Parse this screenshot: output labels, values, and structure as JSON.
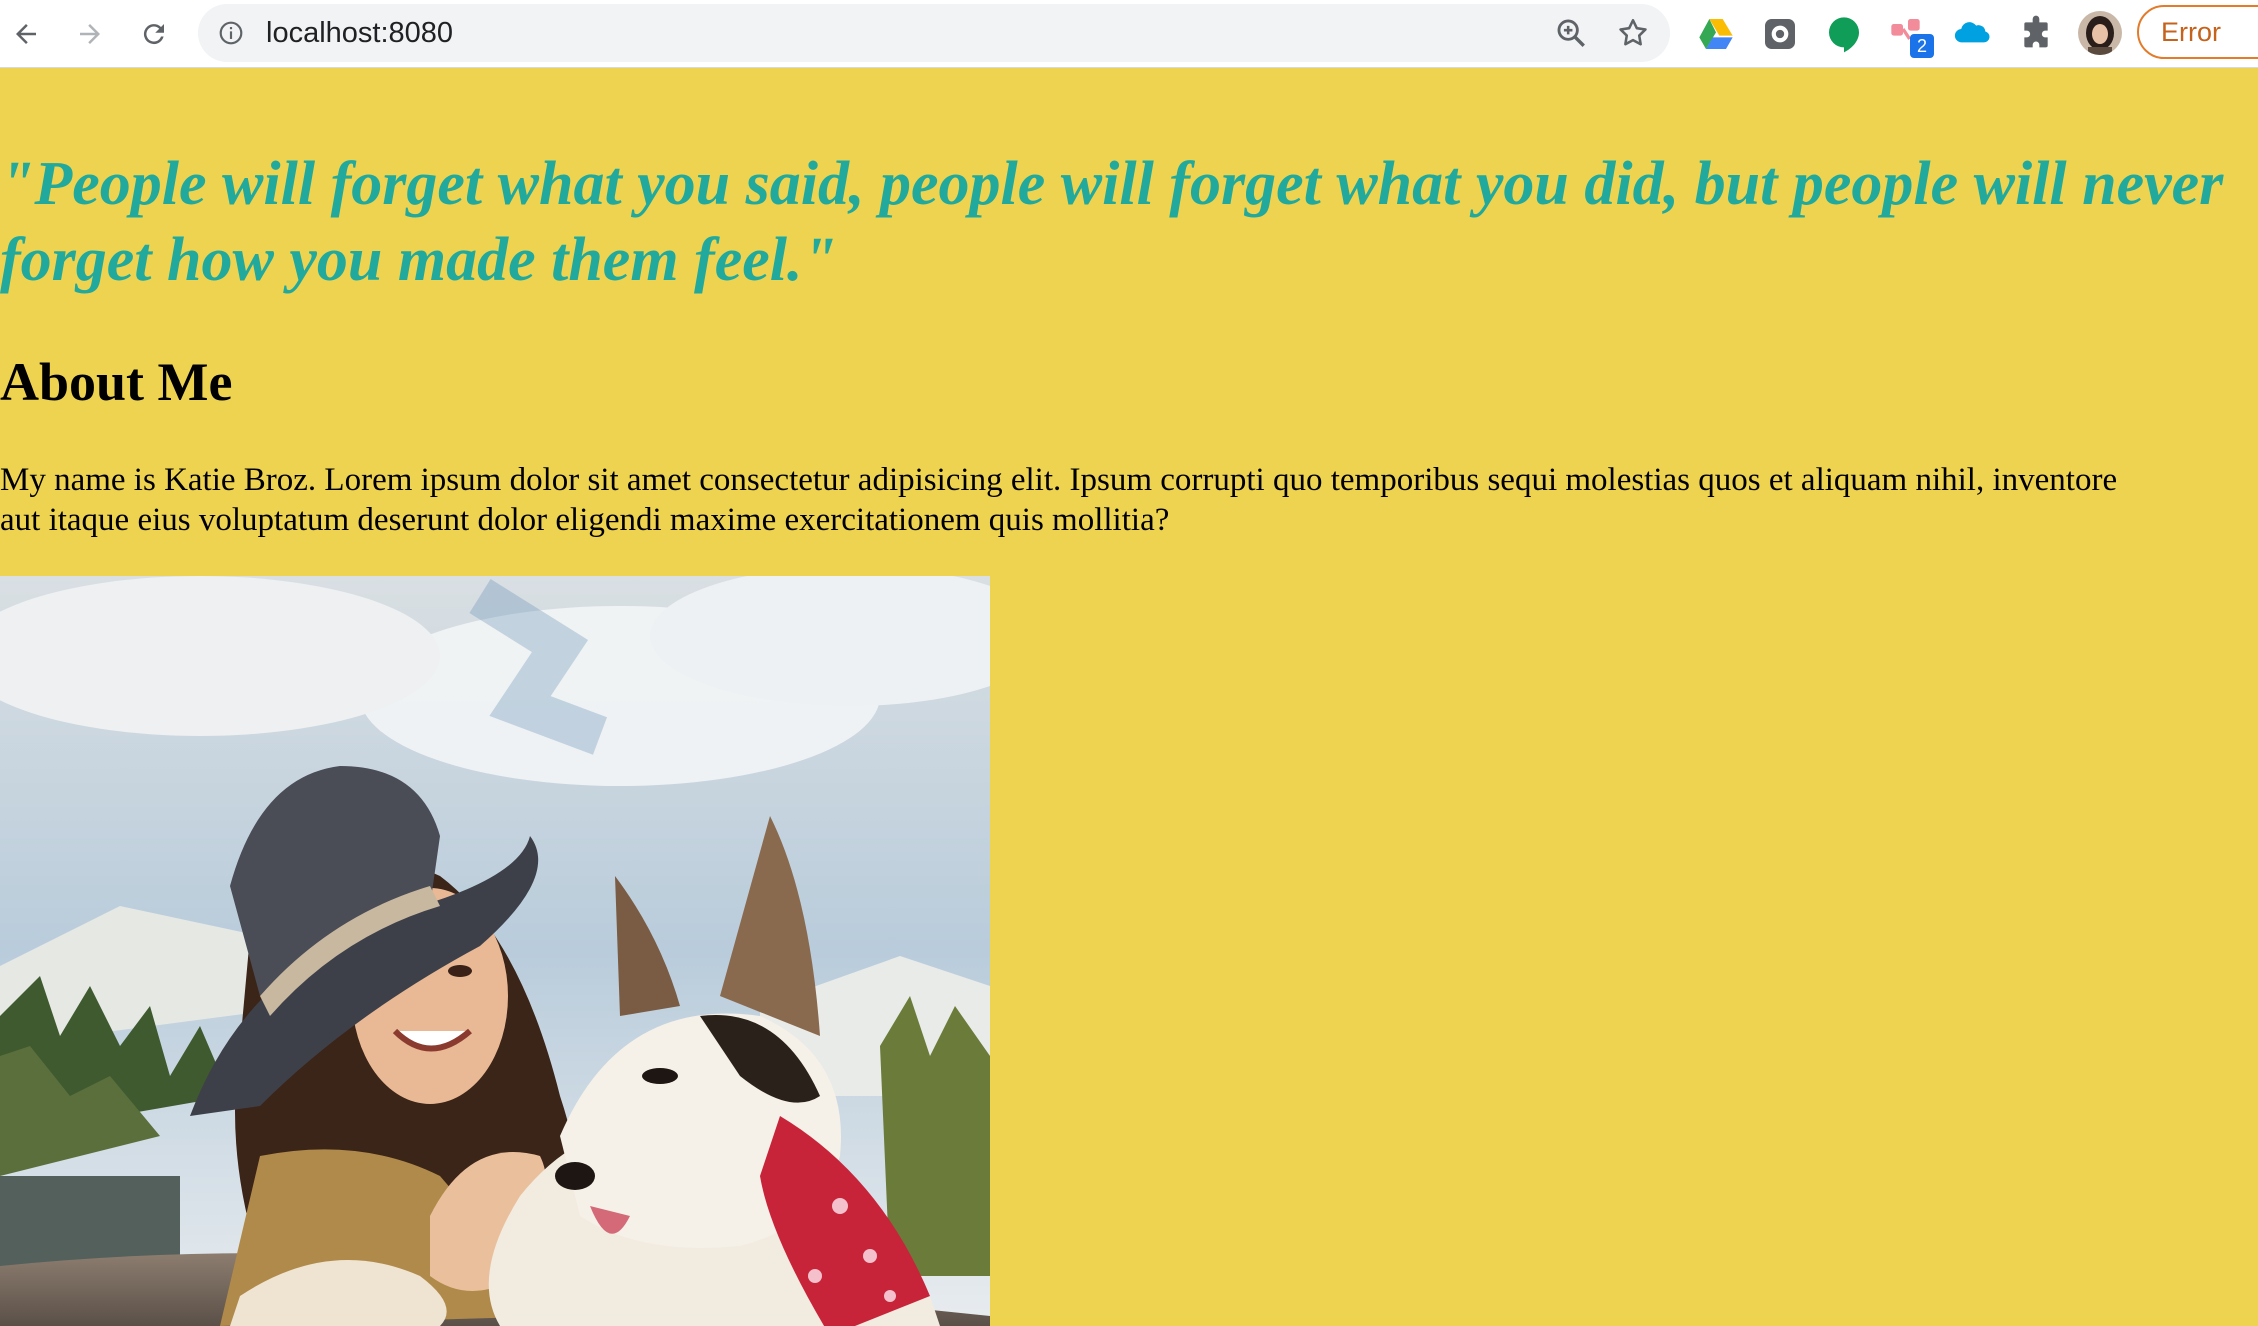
{
  "browser": {
    "url": "localhost:8080",
    "error_label": "Error",
    "extension_badge": "2",
    "icons": [
      "back-arrow-icon",
      "forward-arrow-icon",
      "reload-icon",
      "site-info-icon",
      "zoom-icon",
      "bookmark-star-icon",
      "google-drive-icon",
      "extension-icon",
      "hangouts-icon",
      "extension-badge-icon",
      "salesforce-icon",
      "extensions-puzzle-icon",
      "profile-avatar"
    ]
  },
  "page": {
    "quote": "\"People will forget what you said, people will forget what you did, but people will never forget how you made them feel.\"",
    "about_heading": "About Me",
    "bio_line1": "My name is Katie Broz. Lorem ipsum dolor sit amet consectetur adipisicing elit. Ipsum corrupti quo temporibus sequi molestias quos et aliquam nihil, inventore",
    "bio_line2": "aut itaque eius voluptatum deserunt dolor eligendi maxime exercitationem quis mollitia?"
  },
  "colors": {
    "background": "#EDD350",
    "quote": "#20A99C",
    "error_border": "#E37B2B"
  }
}
